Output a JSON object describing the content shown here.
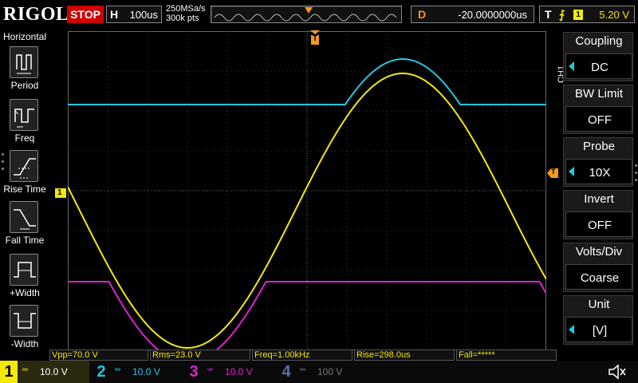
{
  "topbar": {
    "logo": "RIGOL",
    "status": "STOP",
    "timebase_label": "H",
    "timebase_value": "100us",
    "sample_rate": "250MSa/s",
    "memory_depth": "300k pts",
    "delay_label": "D",
    "delay_value": "-20.0000000us",
    "trigger_label": "T",
    "trigger_edge": "⨍",
    "trigger_source": "1",
    "trigger_level": "5.20 V",
    "trigger_marker": "T"
  },
  "left_menu": {
    "title": "Horizontal",
    "items": [
      {
        "label": "Period",
        "icon": "period-icon"
      },
      {
        "label": "Freq",
        "icon": "freq-icon"
      },
      {
        "label": "Rise Time",
        "icon": "rise-time-icon"
      },
      {
        "label": "Fall Time",
        "icon": "fall-time-icon"
      },
      {
        "label": "+Width",
        "icon": "positive-width-icon"
      },
      {
        "label": "-Width",
        "icon": "negative-width-icon"
      }
    ]
  },
  "right_menu": {
    "channel_tag": "CH1",
    "items": [
      {
        "title": "Coupling",
        "value": "DC"
      },
      {
        "title": "BW Limit",
        "value": "OFF"
      },
      {
        "title": "Probe",
        "value": "10X"
      },
      {
        "title": "Invert",
        "value": "OFF"
      },
      {
        "title": "Volts/Div",
        "value": "Coarse"
      },
      {
        "title": "Unit",
        "value": "[V]"
      }
    ]
  },
  "measurements": [
    {
      "text": "Vpp=70.0 V"
    },
    {
      "text": "Rms=23.0 V"
    },
    {
      "text": "Freq=1.00kHz"
    },
    {
      "text": "Rise=298.0us"
    },
    {
      "text": "Fall=*****"
    }
  ],
  "channels": [
    {
      "num": "1",
      "coupling": "═",
      "scale": "10.0 V",
      "color": "#f4e80a",
      "active": true
    },
    {
      "num": "2",
      "coupling": "═",
      "scale": "10.0 V",
      "color": "#23c7e0",
      "active": false
    },
    {
      "num": "3",
      "coupling": "═",
      "scale": "10.0 V",
      "color": "#e020d0",
      "active": false
    },
    {
      "num": "4",
      "coupling": "═",
      "scale": "100 V",
      "color": "#5577aa",
      "active": false
    }
  ],
  "markers": {
    "ch1_ground": "1",
    "trigger_level_marker": "T"
  },
  "colors": {
    "ch1": "#f4e80a",
    "ch2": "#23c7e0",
    "ch3": "#e020d0",
    "ch4": "#5577aa",
    "trigger": "#f39a1e",
    "grid": "#3a3a3a"
  },
  "icons": {
    "speaker": "speaker-muted-icon"
  }
}
